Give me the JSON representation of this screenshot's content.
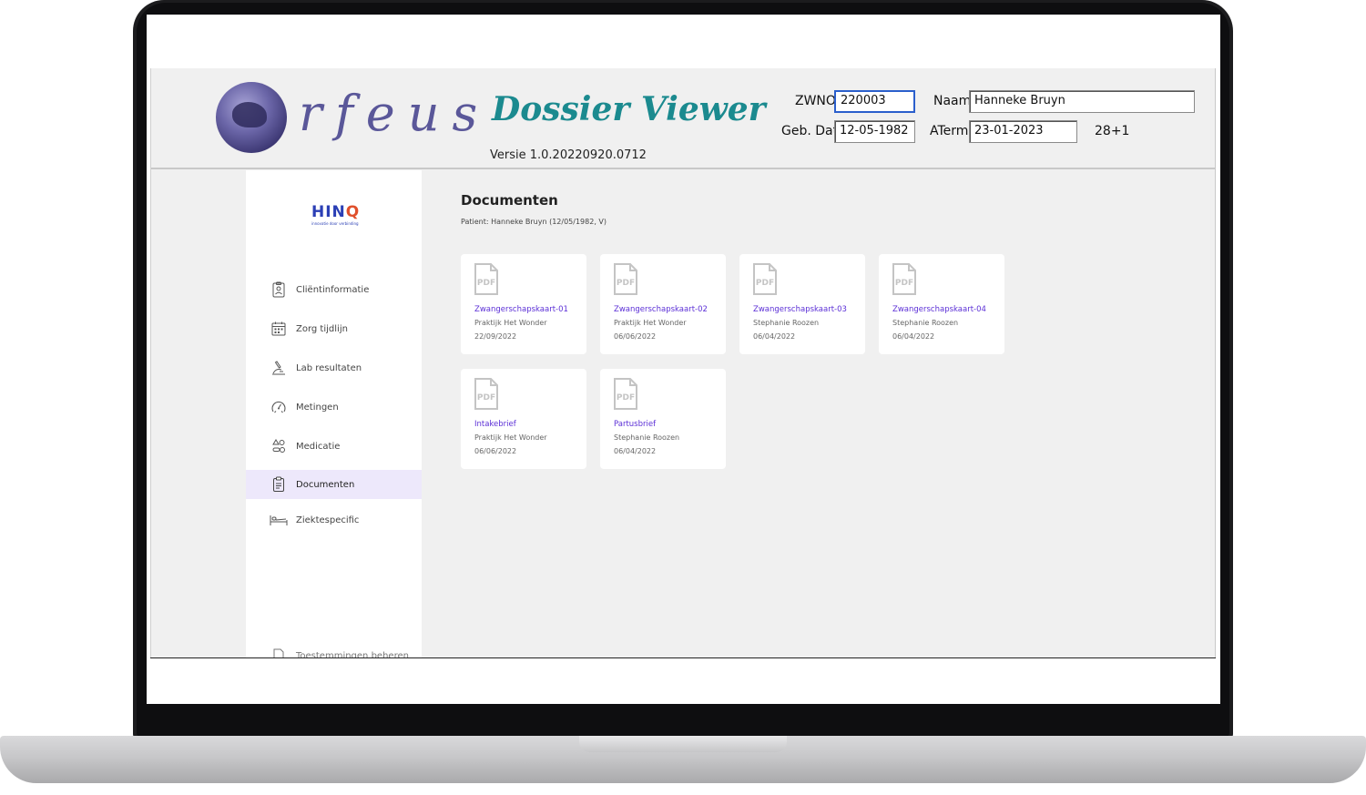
{
  "header": {
    "logo_text": "rfeus",
    "app_title": "Dossier Viewer",
    "version": "Versie 1.0.20220920.0712",
    "zwno_label": "ZWNO",
    "zwno_value": "220003",
    "naam_label": "Naam",
    "naam_value": "Hanneke Bruyn",
    "gebdat_label": "Geb. Dat",
    "gebdat_value": "12-05-1982",
    "aterm_label": "ATerm",
    "aterm_value": "23-01-2023",
    "term_weeks": "28+1"
  },
  "sidebar": {
    "brand": "HIN",
    "brand_q": "Q",
    "brand_sub": "innovatie door verbinding",
    "items": [
      {
        "label": "Cliëntinformatie",
        "icon": "clipboard-person-icon",
        "active": false
      },
      {
        "label": "Zorg tijdlijn",
        "icon": "calendar-icon",
        "active": false
      },
      {
        "label": "Lab resultaten",
        "icon": "microscope-icon",
        "active": false
      },
      {
        "label": "Metingen",
        "icon": "gauge-icon",
        "active": false
      },
      {
        "label": "Medicatie",
        "icon": "pills-icon",
        "active": false
      },
      {
        "label": "Documenten",
        "icon": "clipboard-icon",
        "active": true
      },
      {
        "label": "Ziektespecific",
        "icon": "bed-icon",
        "active": false
      }
    ],
    "footer_item": "Toestemmingen beheren"
  },
  "content": {
    "title": "Documenten",
    "patient": "Patient: Hanneke Bruyn (12/05/1982, V)",
    "documents": [
      {
        "title": "Zwangerschapskaart-01",
        "author": "Praktijk Het Wonder",
        "date": "22/09/2022"
      },
      {
        "title": "Zwangerschapskaart-02",
        "author": "Praktijk Het Wonder",
        "date": "06/06/2022"
      },
      {
        "title": "Zwangerschapskaart-03",
        "author": "Stephanie Roozen",
        "date": "06/04/2022"
      },
      {
        "title": "Zwangerschapskaart-04",
        "author": "Stephanie Roozen",
        "date": "06/04/2022"
      },
      {
        "title": "Intakebrief",
        "author": "Praktijk Het Wonder",
        "date": "06/06/2022"
      },
      {
        "title": "Partusbrief",
        "author": "Stephanie Roozen",
        "date": "06/04/2022"
      }
    ],
    "pdf_label": "PDF"
  },
  "colors": {
    "accent": "#5b2fd6",
    "title_teal": "#1b8a8f",
    "active_bg": "#ede8fb",
    "brand_blue": "#2b3fb5",
    "brand_orange": "#e0502c"
  }
}
